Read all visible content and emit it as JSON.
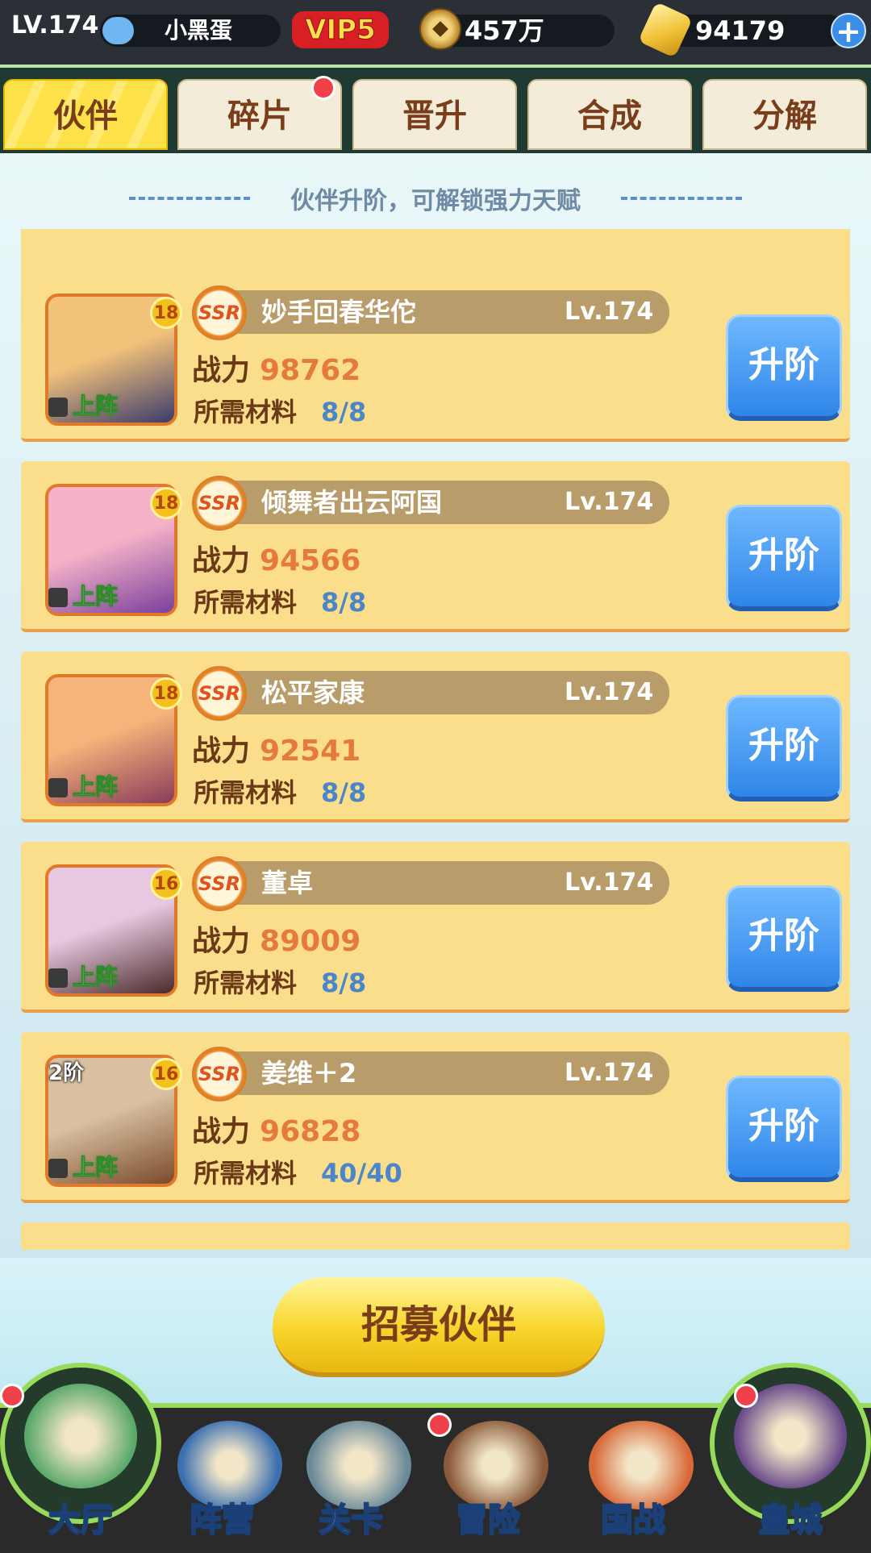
{
  "topbar": {
    "level": "LV.174",
    "player_name": "小黑蛋",
    "exp_progress": 0.18,
    "vip": "VIP5",
    "coins": "457万",
    "gold": "94179"
  },
  "tabs": [
    {
      "label": "伙伴",
      "active": true
    },
    {
      "label": "碎片",
      "active": false,
      "has_dot": true
    },
    {
      "label": "晋升",
      "active": false
    },
    {
      "label": "合成",
      "active": false
    },
    {
      "label": "分解",
      "active": false
    }
  ],
  "hint": "伙伴升阶，可解锁强力天赋",
  "partners": [
    {
      "rarity": "SSR",
      "name": "妙手回春华佗",
      "level": "Lv.174",
      "star": "18",
      "deploy": "上阵",
      "power_label": "战力",
      "power": "98762",
      "material_label": "所需材料",
      "material": "8/8",
      "button": "升阶",
      "avatar_colors": [
        "#f3c27a",
        "#3b3b6b"
      ]
    },
    {
      "rarity": "SSR",
      "name": "倾舞者出云阿国",
      "level": "Lv.174",
      "star": "18",
      "deploy": "上阵",
      "power_label": "战力",
      "power": "94566",
      "material_label": "所需材料",
      "material": "8/8",
      "button": "升阶",
      "avatar_colors": [
        "#f6b3c8",
        "#7a3f9c"
      ]
    },
    {
      "rarity": "SSR",
      "name": "松平家康",
      "level": "Lv.174",
      "star": "18",
      "deploy": "上阵",
      "power_label": "战力",
      "power": "92541",
      "material_label": "所需材料",
      "material": "8/8",
      "button": "升阶",
      "avatar_colors": [
        "#f7b47a",
        "#8a3b5a"
      ]
    },
    {
      "rarity": "SSR",
      "name": "董卓",
      "level": "Lv.174",
      "star": "16",
      "deploy": "上阵",
      "power_label": "战力",
      "power": "89009",
      "material_label": "所需材料",
      "material": "8/8",
      "button": "升阶",
      "avatar_colors": [
        "#e7c8e0",
        "#4a2a2a"
      ]
    },
    {
      "rarity": "SSR",
      "name": "姜维＋2",
      "level": "Lv.174",
      "star": "16",
      "rank": "2阶",
      "deploy": "上阵",
      "power_label": "战力",
      "power": "96828",
      "material_label": "所需材料",
      "material": "40/40",
      "button": "升阶",
      "avatar_colors": [
        "#d8c0a0",
        "#7a4a2a"
      ]
    }
  ],
  "recruit_button": "招募伙伴",
  "nav": [
    {
      "label": "大厅",
      "icon": "castle-icon",
      "has_dot": true
    },
    {
      "label": "阵营",
      "icon": "formation-scroll-icon",
      "has_dot": false
    },
    {
      "label": "关卡",
      "icon": "crossed-swords-icon",
      "has_dot": false
    },
    {
      "label": "冒险",
      "icon": "ship-icon",
      "has_dot": true
    },
    {
      "label": "国战",
      "icon": "war-banner-icon",
      "has_dot": false
    },
    {
      "label": "皇城",
      "icon": "imperial-palace-icon",
      "has_dot": true
    }
  ],
  "colors": {
    "accent_gold": "#f7d52b",
    "card": "#fbde8b",
    "button_blue": "#2f86e8",
    "power_orange": "#e57a3a",
    "material_blue": "#4b86c9"
  }
}
